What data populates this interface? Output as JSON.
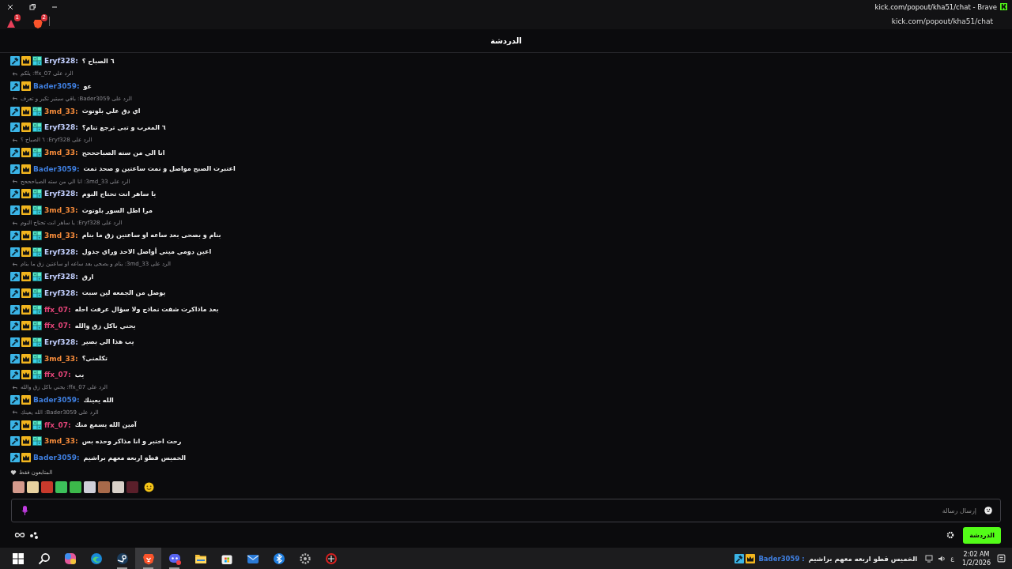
{
  "browser": {
    "title": "kick.com/popout/kha51/chat - Brave",
    "url": "kick.com/popout/kha51/chat",
    "triangle_extension": {
      "badge": "1"
    },
    "lion_extension": {
      "badge": "2"
    }
  },
  "chat": {
    "title": "الدردشة",
    "items": [
      {
        "kind": "message",
        "user": "Eryf328:",
        "color": "#c3d0ff",
        "badges": [
          {
            "kind": "mod"
          },
          {
            "kind": "crown"
          },
          {
            "kind": "og"
          }
        ],
        "text": "٦ الصباح ؟"
      },
      {
        "kind": "reply",
        "text": "الرد على ffx_07: يلكم"
      },
      {
        "kind": "message",
        "user": "Bader3059:",
        "color": "#3f7fe0",
        "badges": [
          {
            "kind": "mod"
          },
          {
            "kind": "crown"
          }
        ],
        "text": "عو"
      },
      {
        "kind": "reply",
        "text": "الرد على Bader3059: باقي سيتير تكير و تعرف"
      },
      {
        "kind": "message",
        "user": "3md_33:",
        "color": "#f48a3a",
        "badges": [
          {
            "kind": "mod"
          },
          {
            "kind": "crown"
          },
          {
            "kind": "og"
          }
        ],
        "text": "اي دق علي بلوتوث"
      },
      {
        "kind": "message",
        "user": "Eryf328:",
        "color": "#c3d0ff",
        "badges": [
          {
            "kind": "mod"
          },
          {
            "kind": "crown"
          },
          {
            "kind": "og"
          }
        ],
        "text": "٦ المغرب و تبي ترجع تنام؟"
      },
      {
        "kind": "reply",
        "text": "الرد على Eryf328: ٦ الصباح ؟"
      },
      {
        "kind": "message",
        "user": "3md_33:",
        "color": "#f48a3a",
        "badges": [
          {
            "kind": "mod"
          },
          {
            "kind": "crown"
          },
          {
            "kind": "og"
          }
        ],
        "text": "انا الي من سته الصباحححح"
      },
      {
        "kind": "message",
        "user": "Bader3059:",
        "color": "#3f7fe0",
        "badges": [
          {
            "kind": "mod"
          },
          {
            "kind": "crown"
          }
        ],
        "text": "اعتبرت الصبح مواصل و نمت ساعتين و صحد تمت"
      },
      {
        "kind": "reply",
        "text": "الرد على 3md_33: انا الي من سته الصباحححح"
      },
      {
        "kind": "message",
        "user": "Eryf328:",
        "color": "#c3d0ff",
        "badges": [
          {
            "kind": "mod"
          },
          {
            "kind": "crown"
          },
          {
            "kind": "og"
          }
        ],
        "text": "يا ساهر انت تحتاج النوم"
      },
      {
        "kind": "message",
        "user": "3md_33:",
        "color": "#f48a3a",
        "badges": [
          {
            "kind": "mod"
          },
          {
            "kind": "crown"
          },
          {
            "kind": "og"
          }
        ],
        "text": "مرا اطل السور بلوتوث"
      },
      {
        "kind": "reply",
        "text": "الرد على Eryf328: يا ساهر انت تحتاج النوم"
      },
      {
        "kind": "message",
        "user": "3md_33:",
        "color": "#f48a3a",
        "badges": [
          {
            "kind": "mod"
          },
          {
            "kind": "crown"
          },
          {
            "kind": "og"
          }
        ],
        "text": "بنام و بصحى بعد ساعه او ساعتين زق ما بنام"
      },
      {
        "kind": "message",
        "user": "Eryf328:",
        "color": "#c3d0ff",
        "badges": [
          {
            "kind": "mod"
          },
          {
            "kind": "crown"
          },
          {
            "kind": "og"
          }
        ],
        "text": "اعين دومي ميني أواصل الاحد وراي جدول"
      },
      {
        "kind": "reply",
        "text": "الرد على 3md_33: بنام و بصحى بعد ساعه او ساعتين زق ما بنام"
      },
      {
        "kind": "message",
        "user": "Eryf328:",
        "color": "#c3d0ff",
        "badges": [
          {
            "kind": "mod"
          },
          {
            "kind": "crown"
          },
          {
            "kind": "og"
          }
        ],
        "text": "ارق"
      },
      {
        "kind": "message",
        "user": "Eryf328:",
        "color": "#c3d0ff",
        "badges": [
          {
            "kind": "mod"
          },
          {
            "kind": "crown"
          },
          {
            "kind": "og"
          }
        ],
        "text": "يوصل من الجمعه لين سبت"
      },
      {
        "kind": "message",
        "user": "ffx_07:",
        "color": "#e6457a",
        "badges": [
          {
            "kind": "mod"
          },
          {
            "kind": "crown"
          },
          {
            "kind": "og"
          }
        ],
        "text": "بعد ماذاكرت شفت نماذج ولا سؤال عرفت احله"
      },
      {
        "kind": "message",
        "user": "ffx_07:",
        "color": "#e6457a",
        "badges": [
          {
            "kind": "mod"
          },
          {
            "kind": "crown"
          },
          {
            "kind": "og"
          }
        ],
        "text": "يحني باكل زق والله"
      },
      {
        "kind": "message",
        "user": "Eryf328:",
        "color": "#c3d0ff",
        "badges": [
          {
            "kind": "mod"
          },
          {
            "kind": "crown"
          },
          {
            "kind": "og"
          }
        ],
        "text": "يب هذا الي بصير"
      },
      {
        "kind": "message",
        "user": "3md_33:",
        "color": "#f48a3a",
        "badges": [
          {
            "kind": "mod"
          },
          {
            "kind": "crown"
          },
          {
            "kind": "og"
          }
        ],
        "text": "تكلمني؟"
      },
      {
        "kind": "message",
        "user": "ffx_07:",
        "color": "#e6457a",
        "badges": [
          {
            "kind": "mod"
          },
          {
            "kind": "crown"
          },
          {
            "kind": "og"
          }
        ],
        "text": "يب"
      },
      {
        "kind": "reply",
        "text": "الرد على ffx_07: يحني باكل زق والله"
      },
      {
        "kind": "message",
        "user": "Bader3059:",
        "color": "#3f7fe0",
        "badges": [
          {
            "kind": "mod"
          },
          {
            "kind": "crown"
          }
        ],
        "text": "الله يعينك"
      },
      {
        "kind": "reply",
        "text": "الرد على Bader3059: الله يعينك"
      },
      {
        "kind": "message",
        "user": "ffx_07:",
        "color": "#e6457a",
        "badges": [
          {
            "kind": "mod"
          },
          {
            "kind": "crown"
          },
          {
            "kind": "og"
          }
        ],
        "text": "آمين الله يسمع منك"
      },
      {
        "kind": "message",
        "user": "3md_33:",
        "color": "#f48a3a",
        "badges": [
          {
            "kind": "mod"
          },
          {
            "kind": "crown"
          },
          {
            "kind": "og"
          }
        ],
        "text": "رحت اختبر و انا مذاكر وحده بس"
      },
      {
        "kind": "message",
        "user": "Bader3059:",
        "color": "#3f7fe0",
        "badges": [
          {
            "kind": "mod"
          },
          {
            "kind": "crown"
          }
        ],
        "text": "الخميس قطو اربعه معهم براشيم"
      }
    ]
  },
  "emote_bar": {
    "label": "المتابعون فقط"
  },
  "composer": {
    "placeholder": "إرسال رسالة"
  },
  "footer": {
    "chat_button": "الدردشة"
  },
  "taskbar": {
    "apps": [
      {
        "kind": "start",
        "open": false,
        "selected": false
      },
      {
        "kind": "search",
        "open": false,
        "selected": false
      },
      {
        "kind": "copilot",
        "open": false,
        "selected": false
      },
      {
        "kind": "edge",
        "open": false,
        "selected": false
      },
      {
        "kind": "steam",
        "open": true,
        "selected": false
      },
      {
        "kind": "brave",
        "open": true,
        "selected": true
      },
      {
        "kind": "discord",
        "open": true,
        "selected": false
      },
      {
        "kind": "explorer",
        "open": false,
        "selected": false
      },
      {
        "kind": "store",
        "open": false,
        "selected": false
      },
      {
        "kind": "mail",
        "open": false,
        "selected": false
      },
      {
        "kind": "bluetooth",
        "open": false,
        "selected": false
      },
      {
        "kind": "gear",
        "open": false,
        "selected": false
      },
      {
        "kind": "ball",
        "open": false,
        "selected": false
      }
    ],
    "ticker": {
      "user": "Bader3059 :",
      "text": "الخميس قطو اربعه معهم براشيم"
    },
    "language": "ع",
    "time": "2:02 AM",
    "date": "1/2/2026"
  }
}
